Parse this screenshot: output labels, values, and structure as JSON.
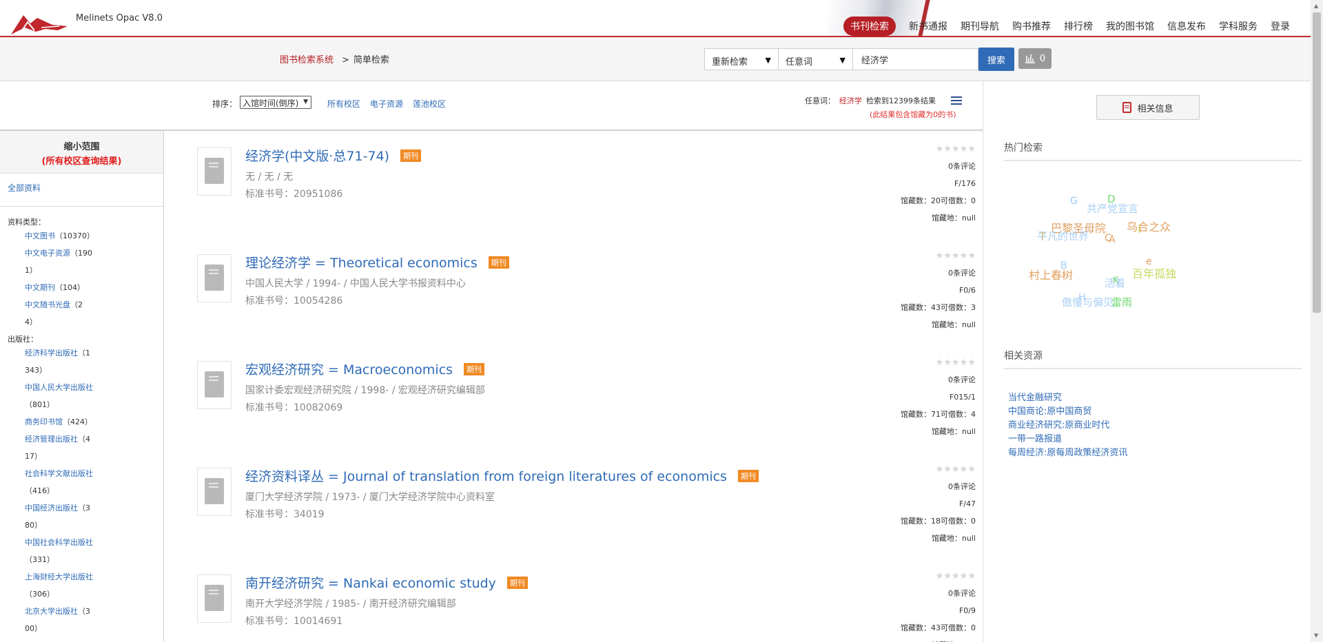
{
  "header": {
    "app_title": "Melinets Opac V8.0",
    "nav": [
      "书刊检索",
      "新书通报",
      "期刊导航",
      "购书推荐",
      "排行榜",
      "我的图书馆",
      "信息发布",
      "学科服务",
      "登录"
    ]
  },
  "searchbar": {
    "breadcrumb_root": "图书检索系统",
    "breadcrumb_sep": ">",
    "breadcrumb_current": "简单检索",
    "mode": "重新检索",
    "field": "任意词",
    "query": "经济学",
    "search_label": "搜索",
    "cart_count": "0"
  },
  "sortrow": {
    "sort_label": "排序：",
    "sort_value": "入馆时间(倒序)",
    "scopes": [
      "所有校区",
      "电子资源",
      "莲池校区"
    ],
    "result_field": "任意词：",
    "result_keyword": "经济学",
    "result_count_text": "检索到12399条结果",
    "result_note": "(此结果包含馆藏为0的书)"
  },
  "filters": {
    "title": "缩小范围",
    "subtitle": "(所有校区查询结果)",
    "all_label": "全部资料",
    "type_head": "资料类型：",
    "types": [
      {
        "l1": "中文图书",
        "l1c": "（10370）",
        "l2": ""
      },
      {
        "l1": "中文电子资源",
        "l1c": "（190",
        "l2": "1）"
      },
      {
        "l1": "中文期刊",
        "l1c": "（104）",
        "l2": ""
      },
      {
        "l1": "中文随书光盘",
        "l1c": "（2",
        "l2": "4）"
      }
    ],
    "publisher_head": "出版社：",
    "publishers": [
      {
        "l1": "经济科学出版社",
        "l1c": "（1",
        "l2": "343）"
      },
      {
        "l1": "中国人民大学出版社",
        "l1c": "",
        "l2": "（801）"
      },
      {
        "l1": "商务印书馆",
        "l1c": "（424）",
        "l2": ""
      },
      {
        "l1": "经济管理出版社",
        "l1c": "（4",
        "l2": "17）"
      },
      {
        "l1": "社会科学文献出版社",
        "l1c": "",
        "l2": "（416）"
      },
      {
        "l1": "中国经济出版社",
        "l1c": "（3",
        "l2": "80）"
      },
      {
        "l1": "中国社会科学出版社",
        "l1c": "",
        "l2": "（331）"
      },
      {
        "l1": "上海财经大学出版社",
        "l1c": "",
        "l2": "（306）"
      },
      {
        "l1": "北京大学出版社",
        "l1c": "（3",
        "l2": "00）"
      }
    ]
  },
  "results": [
    {
      "title": "经济学(中文版·总71-74)",
      "badge": "期刊",
      "pub": "无 / 无 / 无",
      "isbn": "标准书号：20951086",
      "rating": "0",
      "reviews": "0条评论",
      "callno": "F/176",
      "holdings": "馆藏数：20可借数：0",
      "location": "馆藏地：null"
    },
    {
      "title": "理论经济学 = Theoretical economics",
      "badge": "期刊",
      "pub": "中国人民大学 / 1994- / 中国人民大学书报资料中心",
      "isbn": "标准书号：10054286",
      "rating": "0",
      "reviews": "0条评论",
      "callno": "F0/6",
      "holdings": "馆藏数：43可借数：3",
      "location": "馆藏地：null"
    },
    {
      "title": "宏观经济研究 = Macroeconomics",
      "badge": "期刊",
      "pub": "国家计委宏观经济研究院 / 1998- / 宏观经济研究编辑部",
      "isbn": "标准书号：10082069",
      "rating": "0",
      "reviews": "0条评论",
      "callno": "F015/1",
      "holdings": "馆藏数：71可借数：4",
      "location": "馆藏地：null"
    },
    {
      "title": "经济资料译丛 = Journal of translation from foreign literatures of economics",
      "badge": "期刊",
      "pub": "厦门大学经济学院 / 1973- / 厦门大学经济学院中心资料室",
      "isbn": "标准书号：34019",
      "rating": "0",
      "reviews": "0条评论",
      "callno": "F/47",
      "holdings": "馆藏数：18可借数：0",
      "location": "馆藏地：null"
    },
    {
      "title": "南开经济研究 = Nankai economic study",
      "badge": "期刊",
      "pub": "南开大学经济学院 / 1985- / 南开经济研究编辑部",
      "isbn": "标准书号：10014691",
      "rating": "0",
      "reviews": "0条评论",
      "callno": "F0/9",
      "holdings": "馆藏数：43可借数：0",
      "location": "馆藏地：null"
    }
  ],
  "right": {
    "related_info_label": "相关信息",
    "hot_head": "热门检索",
    "hot_tags": [
      {
        "text": "G",
        "color": "#9ec6ef"
      },
      {
        "text": "共产党宣言",
        "color": "#a8cff5"
      },
      {
        "text": "D",
        "color": "#6fd86f"
      },
      {
        "text": "巴黎圣母院",
        "color": "#e0a060"
      },
      {
        "text": "乌合之众",
        "color": "#e0a060"
      },
      {
        "text": "平凡的世界",
        "color": "#a8cff5"
      },
      {
        "text": "T",
        "color": "#e0c080"
      },
      {
        "text": "I",
        "color": "#c8d860"
      },
      {
        "text": "C",
        "color": "#e0a060"
      },
      {
        "text": "A",
        "color": "#e0a060"
      },
      {
        "text": "e",
        "color": "#e0a060"
      },
      {
        "text": "B",
        "color": "#a8cff5"
      },
      {
        "text": "活着",
        "color": "#a8cff5"
      },
      {
        "text": "村上春树",
        "color": "#e0a060"
      },
      {
        "text": "百年孤独",
        "color": "#c8d860"
      },
      {
        "text": "K",
        "color": "#6fd86f"
      },
      {
        "text": "活着",
        "color": "#a8cff5"
      },
      {
        "text": "H",
        "color": "#a8cff5"
      },
      {
        "text": "傲慢与偏见",
        "color": "#a8cff5"
      },
      {
        "text": "雷雨",
        "color": "#6fd86f"
      }
    ],
    "resources_head": "相关资源",
    "resources": [
      "当代金融研究",
      "中国商论:原中国商贸",
      "商业经济研究:原商业时代",
      "一带一路报道",
      "每周经济:原每周政策经济资讯"
    ]
  }
}
